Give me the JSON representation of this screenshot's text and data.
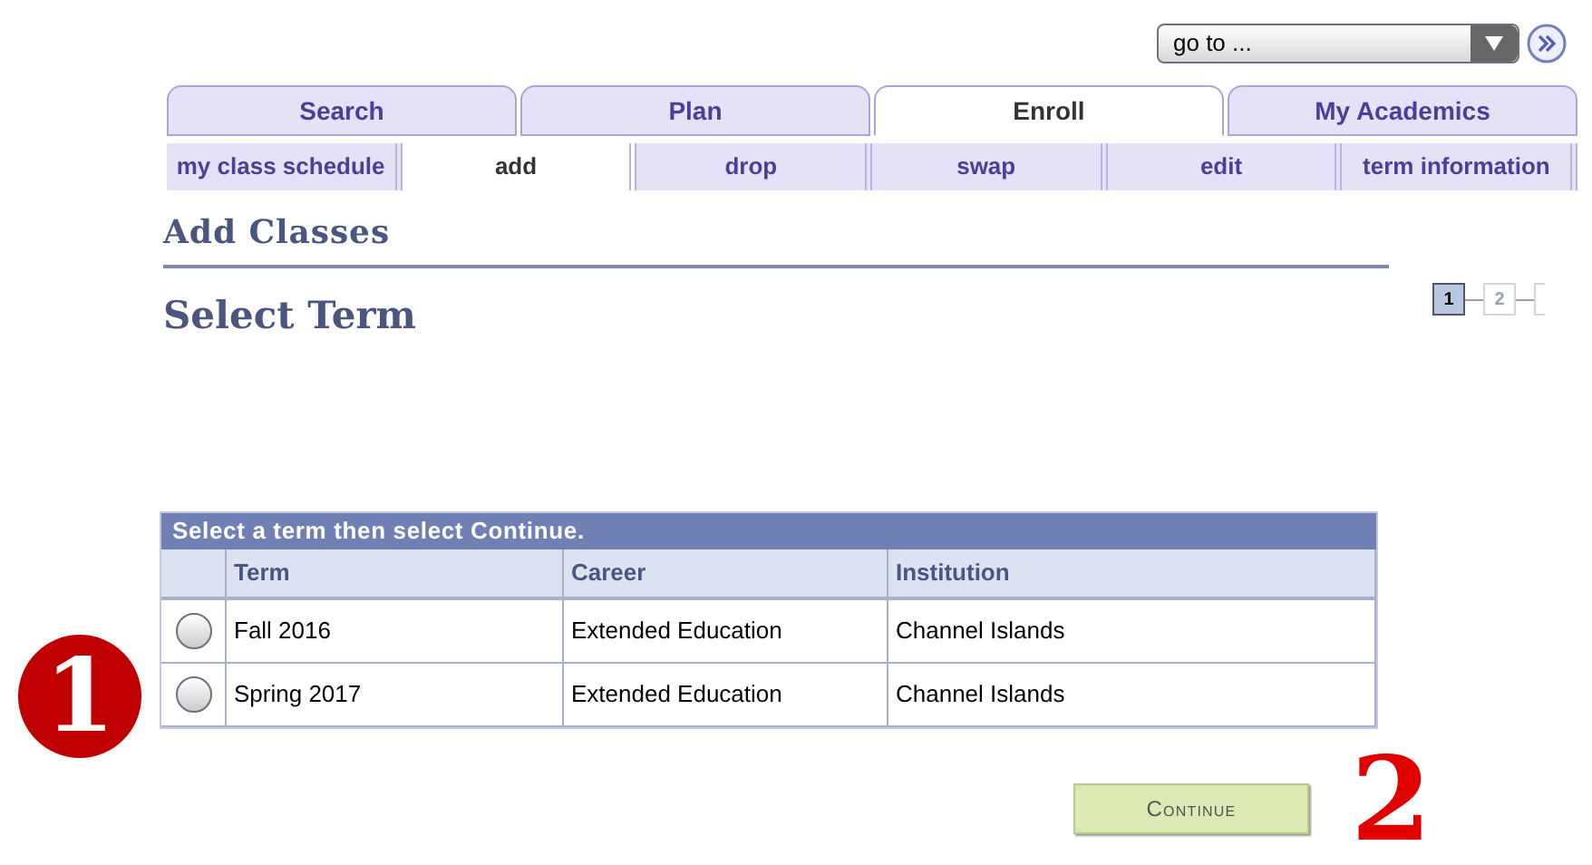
{
  "goto": {
    "value": "go to ..."
  },
  "tabs": [
    {
      "label": "Search",
      "selected": false
    },
    {
      "label": "Plan",
      "selected": false
    },
    {
      "label": "Enroll",
      "selected": true
    },
    {
      "label": "My Academics",
      "selected": false
    }
  ],
  "subtabs": [
    {
      "label": "my class schedule",
      "selected": false
    },
    {
      "label": "add",
      "selected": true
    },
    {
      "label": "drop",
      "selected": false
    },
    {
      "label": "swap",
      "selected": false
    },
    {
      "label": "edit",
      "selected": false
    },
    {
      "label": "term information",
      "selected": false
    }
  ],
  "page_title": "Add Classes",
  "section_title": "Select Term",
  "steps": [
    {
      "label": "1",
      "selected": true
    },
    {
      "label": "2",
      "selected": false
    }
  ],
  "table": {
    "caption": "Select a term then select Continue.",
    "columns": [
      "Term",
      "Career",
      "Institution"
    ],
    "rows": [
      {
        "selected": false,
        "cells": [
          "Fall 2016",
          "Extended Education",
          "Channel Islands"
        ]
      },
      {
        "selected": false,
        "cells": [
          "Spring 2017",
          "Extended Education",
          "Channel Islands"
        ]
      }
    ]
  },
  "continue_button": "Continue",
  "callouts": [
    {
      "label": "1",
      "kind": "circle"
    },
    {
      "label": "2",
      "kind": "plain"
    }
  ]
}
